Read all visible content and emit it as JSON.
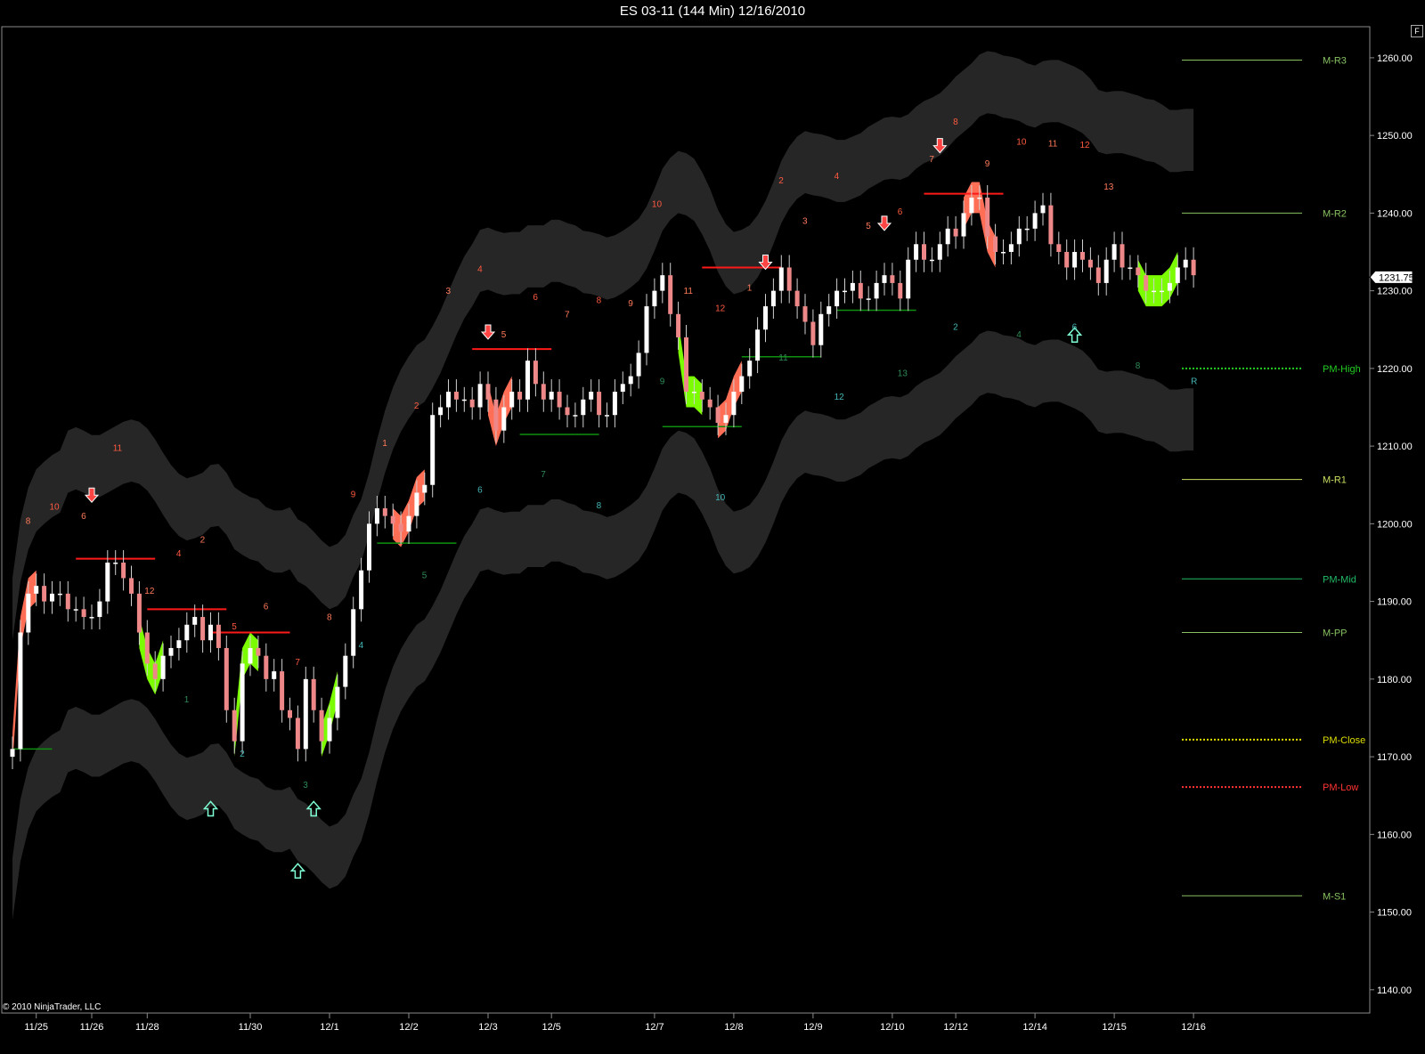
{
  "window": {
    "title": "ES 03-11 (144 Min)  12/16/2010",
    "button_label": "F",
    "copyright": "© 2010 NinjaTrader, LLC",
    "last_price": "1231.75"
  },
  "colors": {
    "background": "#000000",
    "up_candle": "#ffffff",
    "down_candle": "#ee8888",
    "band": "#2a2a2a",
    "sell_ribbon": "#ff6e55",
    "buy_ribbon": "#7cfc00",
    "resistance": "#ff1a1a",
    "support": "#0f8f0f"
  },
  "chart_data": {
    "type": "candlestick",
    "title": "ES 03-11 (144 Min)  12/16/2010",
    "y_axis": {
      "ylim": [
        1137,
        1264
      ],
      "ticks": [
        "1140.00",
        "1150.00",
        "1160.00",
        "1170.00",
        "1180.00",
        "1190.00",
        "1200.00",
        "1210.00",
        "1220.00",
        "1230.00",
        "1240.00",
        "1250.00",
        "1260.00"
      ],
      "position": "right"
    },
    "x_axis": {
      "ticks": [
        "11/25",
        "11/26",
        "11/28",
        "11/30",
        "12/1",
        "12/2",
        "12/3",
        "12/5",
        "12/7",
        "12/8",
        "12/9",
        "12/10",
        "12/12",
        "12/14",
        "12/15",
        "12/16"
      ],
      "tick_bar_index": [
        3,
        10,
        17,
        30,
        40,
        50,
        60,
        68,
        81,
        91,
        101,
        111,
        119,
        129,
        139,
        149
      ]
    },
    "grid": false,
    "levels": [
      {
        "label": "M-R3",
        "value": 1259.7,
        "color": "#88c060",
        "style": "solid"
      },
      {
        "label": "M-R2",
        "value": 1240.0,
        "color": "#88c060",
        "style": "solid"
      },
      {
        "label": "PM-High",
        "value": 1220.0,
        "color": "#22cc22",
        "style": "dotted"
      },
      {
        "label": "M-R1",
        "value": 1205.7,
        "color": "#c8e060",
        "style": "solid"
      },
      {
        "label": "PM-Mid",
        "value": 1192.9,
        "color": "#22bb66",
        "style": "solid"
      },
      {
        "label": "M-PP",
        "value": 1186.0,
        "color": "#88c060",
        "style": "solid"
      },
      {
        "label": "PM-Close",
        "value": 1172.2,
        "color": "#dddd00",
        "style": "dotted"
      },
      {
        "label": "PM-Low",
        "value": 1166.1,
        "color": "#ff3333",
        "style": "dotted"
      },
      {
        "label": "M-S1",
        "value": 1152.1,
        "color": "#88c060",
        "style": "solid"
      }
    ],
    "closes": [
      1171,
      1186,
      1191,
      1192,
      1190,
      1191,
      1191,
      1189,
      1189,
      1188,
      1188,
      1190,
      1195,
      1195,
      1193,
      1191,
      1186,
      1182,
      1180,
      1183,
      1184,
      1185,
      1187,
      1188,
      1185,
      1187,
      1184,
      1176,
      1172,
      1182,
      1184,
      1183,
      1180,
      1181,
      1176,
      1175,
      1171,
      1180,
      1176,
      1172,
      1175,
      1179,
      1183,
      1189,
      1194,
      1200,
      1202,
      1201,
      1200,
      1199,
      1201,
      1204,
      1205,
      1214,
      1215,
      1217,
      1216,
      1216,
      1215,
      1218,
      1216,
      1212,
      1215,
      1217,
      1216,
      1221,
      1218,
      1216,
      1217,
      1215,
      1214,
      1214,
      1216,
      1217,
      1214,
      1214,
      1217,
      1218,
      1219,
      1222,
      1228,
      1230,
      1232,
      1227,
      1224,
      1217,
      1217,
      1216,
      1215,
      1213,
      1214,
      1217,
      1219,
      1221,
      1225,
      1228,
      1230,
      1233,
      1230,
      1228,
      1226,
      1223,
      1227,
      1228,
      1230,
      1230,
      1231,
      1229,
      1229,
      1231,
      1232,
      1231,
      1229,
      1234,
      1236,
      1234,
      1234,
      1236,
      1238,
      1237,
      1240,
      1242,
      1242,
      1237,
      1235,
      1235,
      1236,
      1238,
      1238,
      1240,
      1241,
      1236,
      1235,
      1233,
      1235,
      1234,
      1233,
      1231,
      1234,
      1236,
      1233,
      1233,
      1232,
      1230,
      1230,
      1230,
      1231,
      1233,
      1234,
      1232
    ],
    "resistance_lines": [
      {
        "from_bar": 8,
        "to_bar": 18,
        "value": 1195.5
      },
      {
        "from_bar": 17,
        "to_bar": 27,
        "value": 1189
      },
      {
        "from_bar": 25,
        "to_bar": 35,
        "value": 1186
      },
      {
        "from_bar": 58,
        "to_bar": 68,
        "value": 1222.5
      },
      {
        "from_bar": 87,
        "to_bar": 97,
        "value": 1233
      },
      {
        "from_bar": 115,
        "to_bar": 125,
        "value": 1242.5
      }
    ],
    "support_lines": [
      {
        "from_bar": 0,
        "to_bar": 5,
        "value": 1171
      },
      {
        "from_bar": 46,
        "to_bar": 56,
        "value": 1197.5
      },
      {
        "from_bar": 64,
        "to_bar": 74,
        "value": 1211.5
      },
      {
        "from_bar": 82,
        "to_bar": 92,
        "value": 1212.5
      },
      {
        "from_bar": 92,
        "to_bar": 102,
        "value": 1221.5
      },
      {
        "from_bar": 104,
        "to_bar": 114,
        "value": 1227.5
      }
    ],
    "sell_arrows": [
      {
        "bar": 10,
        "value": 1203
      },
      {
        "bar": 60,
        "value": 1224
      },
      {
        "bar": 95,
        "value": 1233
      },
      {
        "bar": 110,
        "value": 1238
      },
      {
        "bar": 117,
        "value": 1248
      }
    ],
    "buy_arrows": [
      {
        "bar": 25,
        "value": 1164
      },
      {
        "bar": 36,
        "value": 1156
      },
      {
        "bar": 38,
        "value": 1164
      },
      {
        "bar": 134,
        "value": 1225
      }
    ],
    "sell_counts": [
      "8",
      "10",
      "6",
      "11",
      "12",
      "4",
      "2",
      "5",
      "6",
      "7",
      "8",
      "9",
      "1",
      "2",
      "3",
      "4",
      "5",
      "6",
      "7",
      "8",
      "9",
      "10",
      "11",
      "12",
      "1",
      "2",
      "3",
      "4",
      "5",
      "6",
      "7",
      "8",
      "9",
      "10",
      "11",
      "12",
      "13"
    ],
    "buy_counts": [
      "1",
      "2",
      "3",
      "4",
      "5",
      "6",
      "7",
      "8",
      "9",
      "10",
      "11",
      "12",
      "13",
      "2",
      "4",
      "6",
      "8",
      "R"
    ]
  }
}
